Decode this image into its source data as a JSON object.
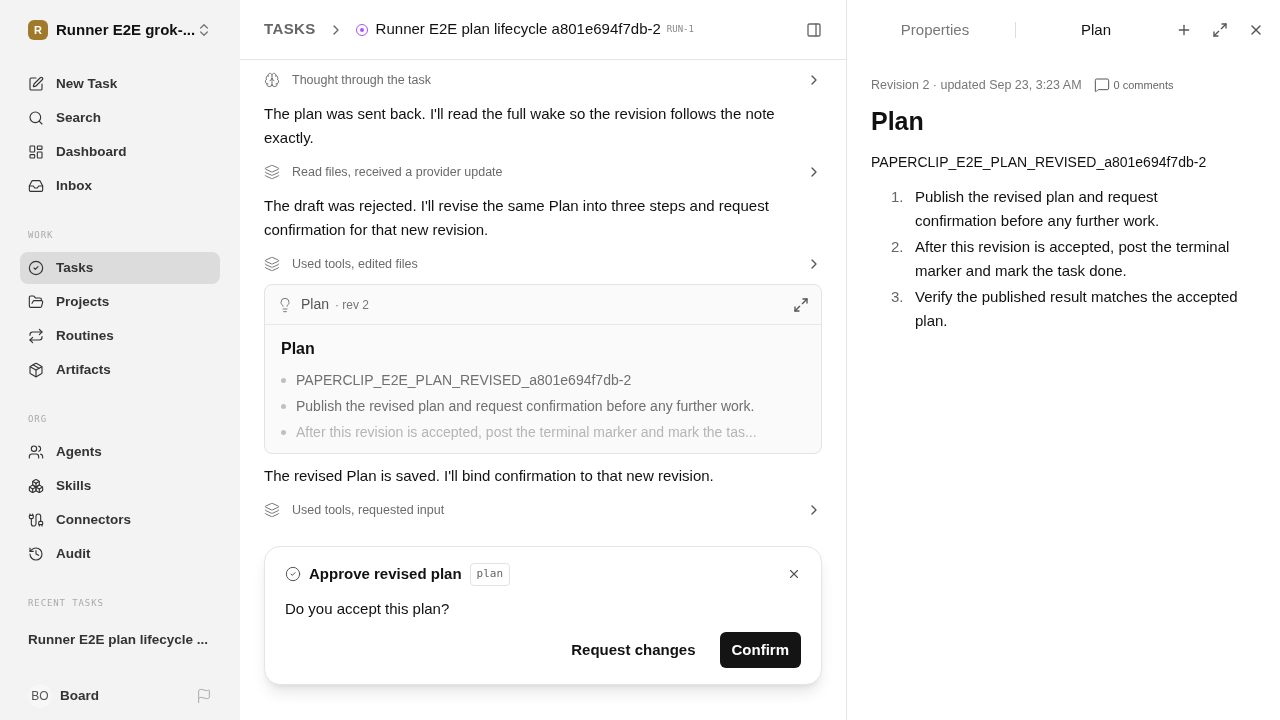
{
  "workspace": {
    "initial": "R",
    "name": "Runner E2E grok-..."
  },
  "nav_groups": [
    {
      "items": [
        {
          "label": "New Task",
          "selected": false
        },
        {
          "label": "Search",
          "selected": false
        },
        {
          "label": "Dashboard",
          "selected": false
        },
        {
          "label": "Inbox",
          "selected": false
        }
      ]
    },
    {
      "heading": "WORK",
      "items": [
        {
          "label": "Tasks",
          "selected": true
        },
        {
          "label": "Projects",
          "selected": false
        },
        {
          "label": "Routines",
          "selected": false
        },
        {
          "label": "Artifacts",
          "selected": false
        }
      ]
    },
    {
      "heading": "ORG",
      "items": [
        {
          "label": "Agents",
          "selected": false
        },
        {
          "label": "Skills",
          "selected": false
        },
        {
          "label": "Connectors",
          "selected": false
        },
        {
          "label": "Audit",
          "selected": false
        }
      ]
    }
  ],
  "recent_tasks": {
    "heading": "RECENT TASKS",
    "items": [
      "Runner E2E plan lifecycle ..."
    ]
  },
  "user": {
    "initials": "BO",
    "name": "Board"
  },
  "breadcrumb": {
    "root": "TASKS",
    "title": "Runner E2E plan lifecycle a801e694f7db-2",
    "run": "RUN-1"
  },
  "feed": [
    {
      "kind": "thought",
      "text": "Thought through the task"
    },
    {
      "kind": "message",
      "text": "The plan was sent back. I'll read the full wake so the revision follows the note exactly."
    },
    {
      "kind": "activity",
      "text": "Read files, received a provider update"
    },
    {
      "kind": "message",
      "text": "The draft was rejected. I'll revise the same Plan into three steps and request confirmation for that new revision."
    },
    {
      "kind": "activity",
      "text": "Used tools, edited files"
    },
    {
      "kind": "plan",
      "label": "Plan",
      "revision": "· rev 2",
      "heading": "Plan",
      "bullets": [
        "PAPERCLIP_E2E_PLAN_REVISED_a801e694f7db-2",
        "Publish the revised plan and request confirmation before any further work.",
        "After this revision is accepted, post the terminal marker and mark the tas..."
      ]
    },
    {
      "kind": "message",
      "text": "The revised Plan is saved. I'll bind confirmation to that new revision."
    },
    {
      "kind": "activity",
      "text": "Used tools, requested input"
    }
  ],
  "approval": {
    "title": "Approve revised plan",
    "tag": "plan",
    "question": "Do you accept this plan?",
    "secondary": "Request changes",
    "primary": "Confirm"
  },
  "panel": {
    "tabs": [
      {
        "label": "Properties",
        "selected": false
      },
      {
        "label": "Plan",
        "selected": true
      }
    ],
    "meta": "Revision 2 · updated Sep 23, 3:23 AM",
    "comments": "0 comments",
    "title": "Plan",
    "marker": "PAPERCLIP_E2E_PLAN_REVISED_a801e694f7db-2",
    "steps": [
      {
        "number": "1.",
        "text": "Publish the revised plan and request confirmation before any further work."
      },
      {
        "number": "2.",
        "text": "After this revision is accepted, post the terminal marker and mark the task done."
      },
      {
        "number": "3.",
        "text": "Verify the published result matches the accepted plan."
      }
    ]
  }
}
